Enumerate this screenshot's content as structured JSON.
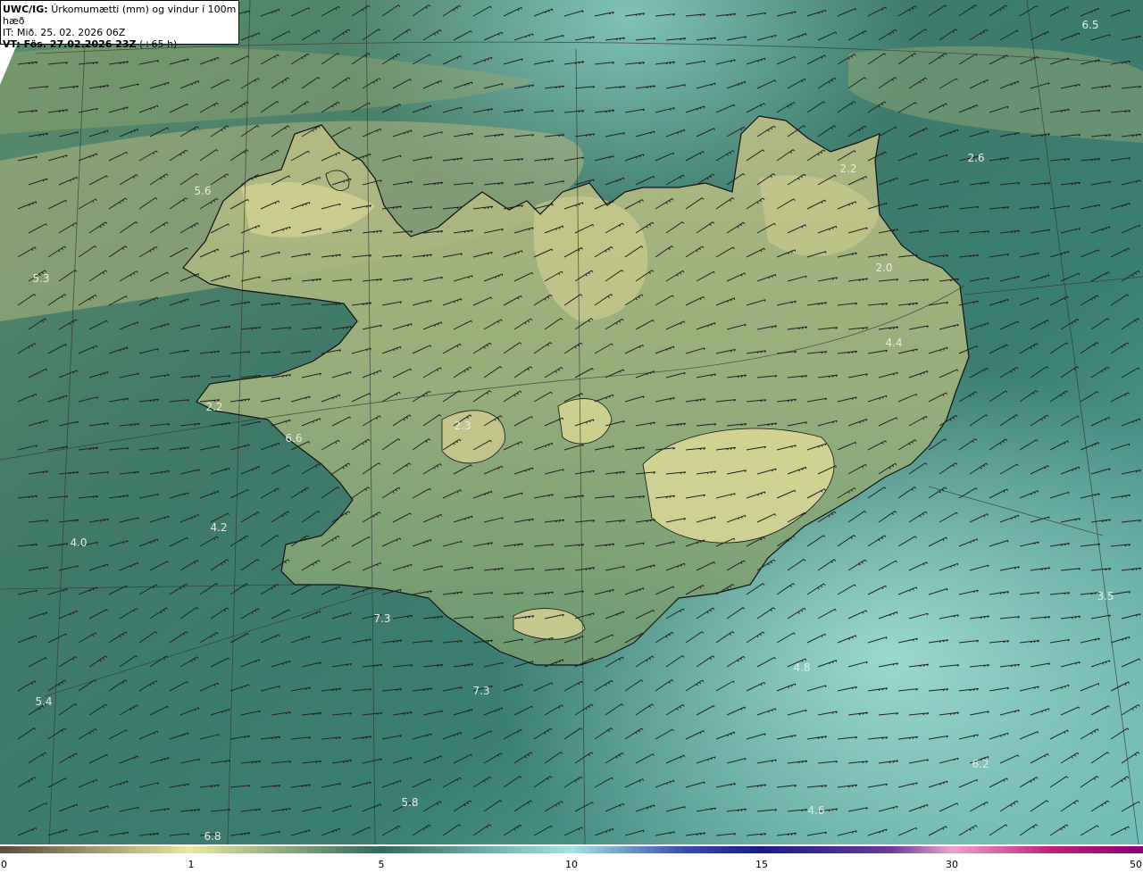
{
  "header": {
    "model_label": "UWC/IG:",
    "title": "Úrkomumætti (mm) og vindur í 100m hæð",
    "init_time": "IT: Mið. 25. 02. 2026 06Z",
    "valid_label": "VT: Fös. 27.02.2026 23Z",
    "valid_offset": "(+65 h)"
  },
  "colorbar": {
    "ticks": [
      "0",
      "1",
      "5",
      "10",
      "15",
      "30",
      "50"
    ],
    "colors": [
      "#5a4a3a",
      "#c9b97a",
      "#e8e89a",
      "#2f6a5e",
      "#9fe6e2",
      "#1a1a8a",
      "#f0a0d0",
      "#c0207a",
      "#8a007a"
    ]
  },
  "map": {
    "colors": {
      "sea_dark": "#2d6a5c",
      "sea_light": "#8fd3cc",
      "land_yellow": "#c8c98a",
      "land_mid": "#6f9a6e",
      "coast": "#111111"
    },
    "station_values": [
      "6.5",
      "2.6",
      "2.2",
      "5.6",
      "5.3",
      "2.0",
      "4.4",
      "2.2",
      "6.6",
      "2.3",
      "4.2",
      "4.0",
      "3.5",
      "7.3",
      "4.8",
      "7.3",
      "5.4",
      "6.2",
      "5.8",
      "4.6",
      "6.8"
    ]
  }
}
